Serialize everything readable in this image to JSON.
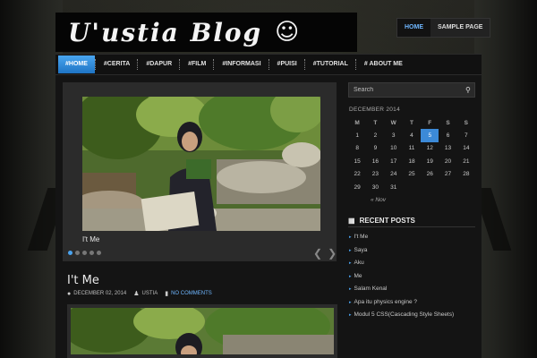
{
  "header": {
    "logo_title": "U'ustia Blog",
    "logo_smile": "☺"
  },
  "top_nav": [
    {
      "label": "HOME",
      "active": true
    },
    {
      "label": "SAMPLE PAGE",
      "active": false
    }
  ],
  "main_nav": [
    {
      "label": "#HOME",
      "active": true
    },
    {
      "label": "#CERITA"
    },
    {
      "label": "#DAPUR"
    },
    {
      "label": "#FILM"
    },
    {
      "label": "#INFORMASI"
    },
    {
      "label": "#PUISI"
    },
    {
      "label": "#TUTORIAL"
    },
    {
      "label": "# ABOUT ME"
    }
  ],
  "slider": {
    "caption": "I't Me",
    "dot_count": 5,
    "active_dot": 0,
    "prev_arrow": "❮",
    "next_arrow": "❯"
  },
  "post": {
    "title": "I't Me",
    "date": "DECEMBER 02, 2014",
    "author": "USTIA",
    "comments": "NO COMMENTS",
    "date_icon": "clock-icon",
    "author_icon": "user-icon",
    "comments_icon": "comment-icon"
  },
  "sidebar": {
    "search": {
      "placeholder": "Search",
      "icon": "search-icon"
    },
    "calendar": {
      "caption": "DECEMBER 2014",
      "weekdays": [
        "M",
        "T",
        "W",
        "T",
        "F",
        "S",
        "S"
      ],
      "weeks": [
        [
          "1",
          "2",
          "3",
          "4",
          "5",
          "6",
          "7"
        ],
        [
          "8",
          "9",
          "10",
          "11",
          "12",
          "13",
          "14"
        ],
        [
          "15",
          "16",
          "17",
          "18",
          "19",
          "20",
          "21"
        ],
        [
          "22",
          "23",
          "24",
          "25",
          "26",
          "27",
          "28"
        ],
        [
          "29",
          "30",
          "31",
          "",
          "",
          "",
          ""
        ]
      ],
      "today": "5",
      "prev_link": "« Nov"
    },
    "recent_posts": {
      "title": "RECENT POSTS",
      "icon": "list-icon",
      "items": [
        "I't Me",
        "Saya",
        "Aku",
        "Me",
        "Salam Kenal",
        "Apa itu physics engine ?",
        "Modul 5 CSS(Cascading Style Sheets)"
      ]
    }
  },
  "colors": {
    "accent": "#3c8ad8",
    "link": "#6fb7ff",
    "background": "#1b1c19"
  }
}
